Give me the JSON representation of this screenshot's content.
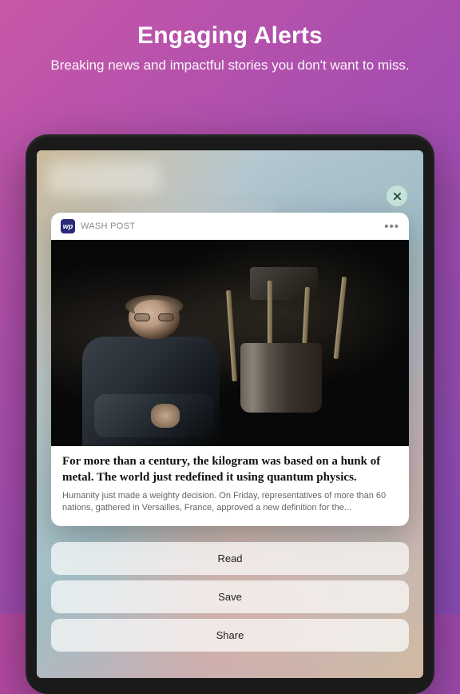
{
  "header": {
    "title": "Engaging Alerts",
    "subtitle": "Breaking news and impactful stories you don't want to miss."
  },
  "notification": {
    "app_icon_text": "wp",
    "app_name": "WASH POST",
    "more_label": "•••",
    "story_title": "For more than a century, the kilogram was based on a hunk of metal. The world just redefined it using quantum physics.",
    "story_summary": "Humanity just made a weighty decision. On Friday, representatives of more than 60 nations, gathered in Versailles, France, approved a new definition for the..."
  },
  "actions": {
    "read": "Read",
    "save": "Save",
    "share": "Share"
  }
}
